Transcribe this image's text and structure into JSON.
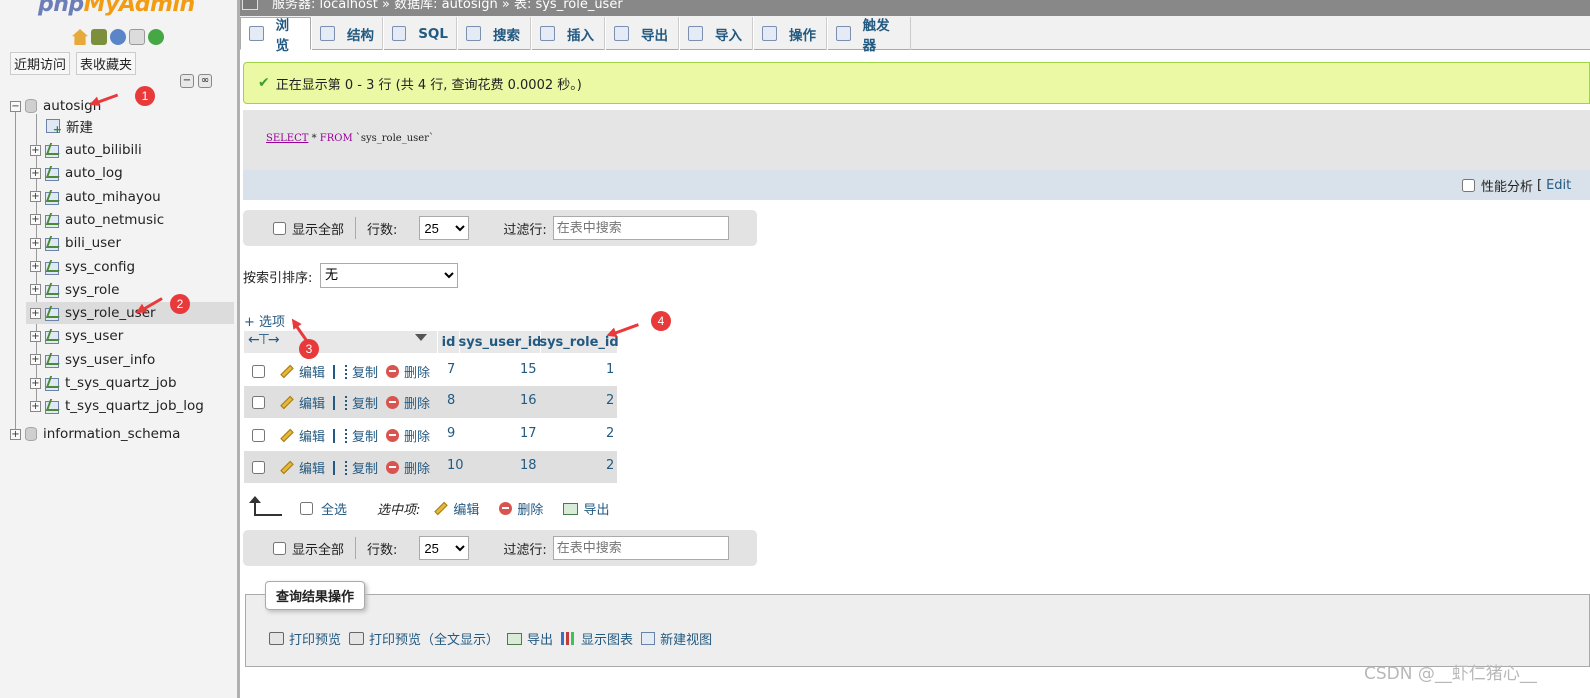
{
  "logo": {
    "part1": "php",
    "part2": "MyAdmin"
  },
  "nav_tabs": [
    "近期访问",
    "表收藏夹"
  ],
  "tree": {
    "db1": "autosign",
    "new_label": "新建",
    "tables": [
      "auto_bilibili",
      "auto_log",
      "auto_mihayou",
      "auto_netmusic",
      "bili_user",
      "sys_config",
      "sys_role",
      "sys_role_user",
      "sys_user",
      "sys_user_info",
      "t_sys_quartz_job",
      "t_sys_quartz_job_log"
    ],
    "db2": "information_schema",
    "selected": "sys_role_user"
  },
  "breadcrumb": "服务器: localhost » 数据库: autosign » 表: sys_role_user",
  "tabs": [
    "浏览",
    "结构",
    "SQL",
    "搜索",
    "插入",
    "导出",
    "导入",
    "操作",
    "触发器"
  ],
  "success_message": "正在显示第 0 - 3 行 (共 4 行, 查询花费 0.0002 秒。)",
  "sql": {
    "kw1": "SELECT",
    "rest1": " * ",
    "kw2": "FROM",
    "rest2": " `sys_role_user`"
  },
  "profiling": {
    "label": "性能分析",
    "bracket": "[",
    "edit": "Edit"
  },
  "navbar": {
    "show_all": "显示全部",
    "rows_label": "行数:",
    "rows_value": "25",
    "filter_label": "过滤行:",
    "filter_placeholder": "在表中搜索"
  },
  "sort": {
    "label": "按索引排序:",
    "value": "无"
  },
  "options_link": "+ 选项",
  "table": {
    "columns": [
      "id",
      "sys_user_id",
      "sys_role_id"
    ],
    "rows": [
      {
        "id": "7",
        "sys_user_id": "15",
        "sys_role_id": "1"
      },
      {
        "id": "8",
        "sys_user_id": "16",
        "sys_role_id": "2"
      },
      {
        "id": "9",
        "sys_user_id": "17",
        "sys_role_id": "2"
      },
      {
        "id": "10",
        "sys_user_id": "18",
        "sys_role_id": "2"
      }
    ],
    "actions": {
      "edit": "编辑",
      "copy": "复制",
      "delete": "删除"
    }
  },
  "bulk": {
    "select_all": "全选",
    "with_selected": "选中项:",
    "edit": "编辑",
    "delete": "删除",
    "export": "导出"
  },
  "query_results": {
    "legend": "查询结果操作",
    "ops": [
      "打印预览",
      "打印预览（全文显示）",
      "导出",
      "显示图表",
      "新建视图"
    ]
  },
  "annotations": [
    "1",
    "2",
    "3",
    "4"
  ],
  "watermark": "CSDN @__虾仁猪心__",
  "colors": {
    "accent": "#235a81",
    "success_bg": "#ebf8a4",
    "annotation_red": "#e8393b"
  }
}
